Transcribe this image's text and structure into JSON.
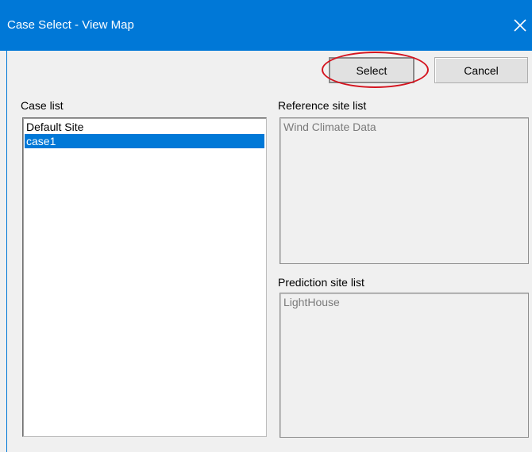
{
  "window": {
    "title": "Case Select - View Map",
    "close_glyph": "✕"
  },
  "buttons": {
    "select_label": "Select",
    "cancel_label": "Cancel"
  },
  "case_list": {
    "label": "Case list",
    "items": [
      {
        "label": "Default Site",
        "selected": false
      },
      {
        "label": "case1",
        "selected": true
      }
    ]
  },
  "reference_site_list": {
    "label": "Reference site list",
    "enabled": false,
    "items": [
      {
        "label": "Wind Climate Data"
      }
    ]
  },
  "prediction_site_list": {
    "label": "Prediction site list",
    "enabled": false,
    "items": [
      {
        "label": "LightHouse"
      }
    ]
  },
  "colors": {
    "titlebar": "#0078d7",
    "selection": "#0078d7",
    "annotation_ring": "#d4141f",
    "dialog_background": "#f0f0f0"
  },
  "icons": {
    "close": "close-icon"
  }
}
